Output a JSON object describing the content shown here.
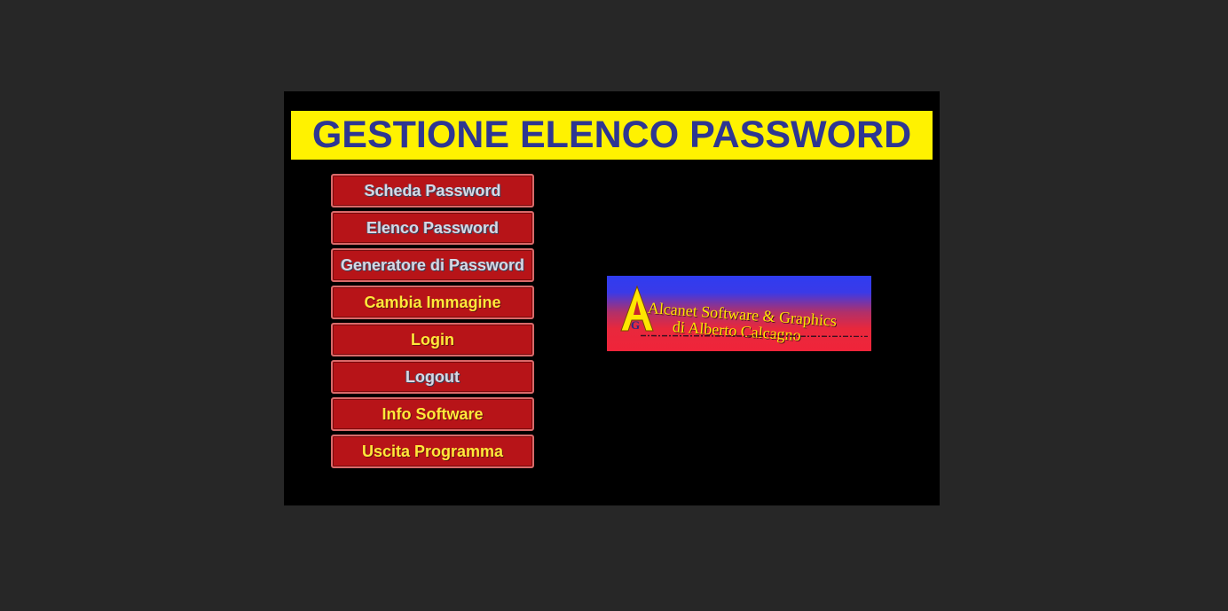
{
  "app": {
    "title": "GESTIONE ELENCO PASSWORD"
  },
  "menu": {
    "items": [
      {
        "label": "Scheda Password",
        "style": "silver"
      },
      {
        "label": "Elenco Password",
        "style": "silver"
      },
      {
        "label": "Generatore di Password",
        "style": "silver"
      },
      {
        "label": "Cambia Immagine",
        "style": "gold"
      },
      {
        "label": "Login",
        "style": "gold"
      },
      {
        "label": "Logout",
        "style": "silver"
      },
      {
        "label": "Info Software",
        "style": "gold"
      },
      {
        "label": "Uscita Programma",
        "style": "gold"
      }
    ]
  },
  "logo": {
    "line1": "Alcanet Software & Graphics",
    "line2": "di Alberto Calcagno",
    "icon": "alcanet-ag-logo-icon"
  },
  "colors": {
    "background": "#272727",
    "window": "#000000",
    "title_bar": "#fff200",
    "title_text": "#2e3692",
    "button": "#b71418",
    "button_text_silver": "#d8d8e4",
    "button_text_gold": "#ffe83a",
    "logo_top": "#2f3cf0",
    "logo_bottom": "#f0243a"
  }
}
